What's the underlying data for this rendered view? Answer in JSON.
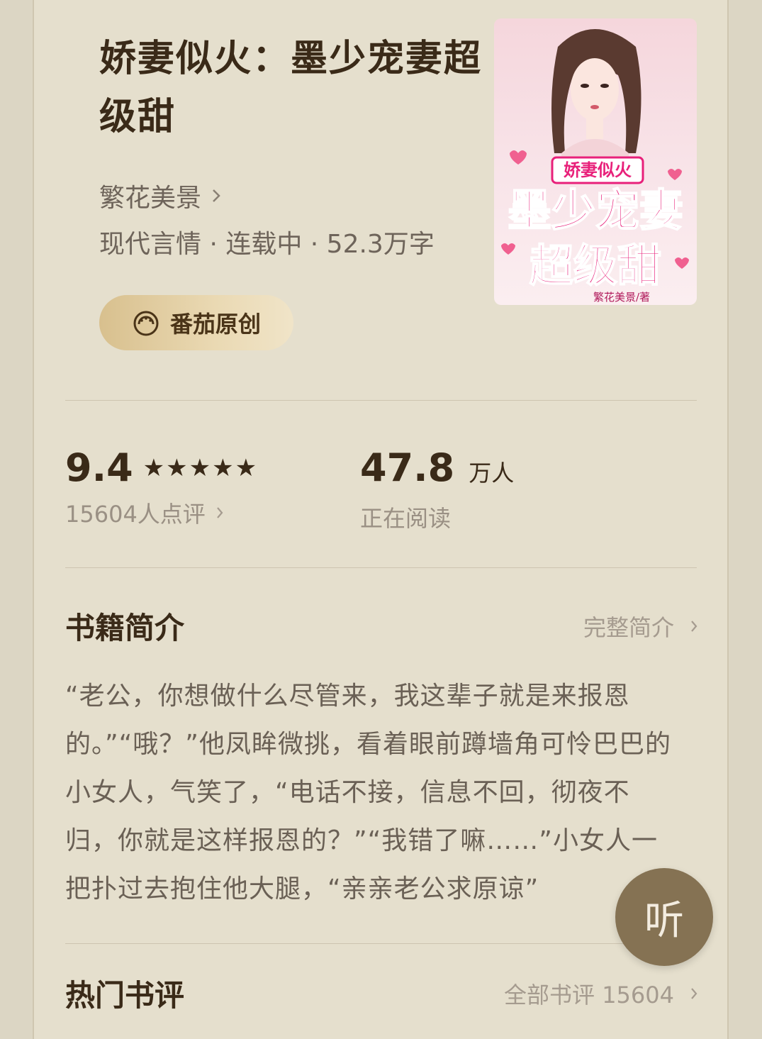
{
  "book": {
    "title": "娇妻似火：墨少宠妻超级甜",
    "author": "繁花美景",
    "meta": "现代言情 · 连载中 · 52.3万字",
    "badge_label": "番茄原创",
    "cover": {
      "title_small": "娇妻似火",
      "title_line1": "墨少宠妻",
      "title_line2": "超级甜",
      "author_credit": "繁花美景/著"
    }
  },
  "stats": {
    "score": "9.4",
    "stars": "★★★★★",
    "star_count": 5,
    "review_count_label": "15604人点评",
    "readers_num": "47.8",
    "readers_unit": "万人",
    "readers_label": "正在阅读"
  },
  "intro_section": {
    "title": "书籍简介",
    "link_label": "完整简介",
    "text": "“老公，你想做什么尽管来，我这辈子就是来报恩的。”“哦？”他凤眸微挑，看着眼前蹲墙角可怜巴巴的小女人，气笑了，“电话不接，信息不回，彻夜不归，你就是这样报恩的？”“我错了嘛……”小女人一把扑过去抱住他大腿，“亲亲老公求原谅”"
  },
  "reviews_section": {
    "title": "热门书评",
    "link_label": "全部书评 15604"
  },
  "listen_button": {
    "label": "听"
  },
  "colors": {
    "background": "#dcd6c4",
    "card": "#e5dfcd",
    "text_dark": "#3a2a18",
    "text_muted": "#9a9084",
    "listen_bg": "#857253",
    "badge_gold": "#d8c08e",
    "cover_pink": "#e8207a"
  },
  "icons": [
    "chevron-right-icon",
    "tomato-logo-icon"
  ]
}
